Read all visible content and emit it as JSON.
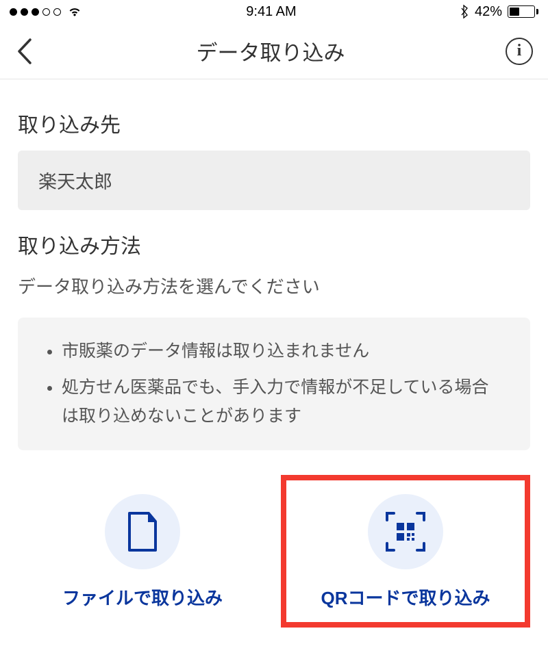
{
  "statusbar": {
    "time": "9:41 AM",
    "battery_pct": "42%"
  },
  "nav": {
    "title": "データ取り込み"
  },
  "destination": {
    "heading": "取り込み先",
    "value": "楽天太郎"
  },
  "method": {
    "heading": "取り込み方法",
    "instruction": "データ取り込み方法を選んでください",
    "notes": [
      "市販薬のデータ情報は取り込まれません",
      "処方せん医薬品でも、手入力で情報が不足している場合は取り込めないことがあります"
    ],
    "options": {
      "file": "ファイルで取り込み",
      "qr": "QRコードで取り込み"
    }
  }
}
